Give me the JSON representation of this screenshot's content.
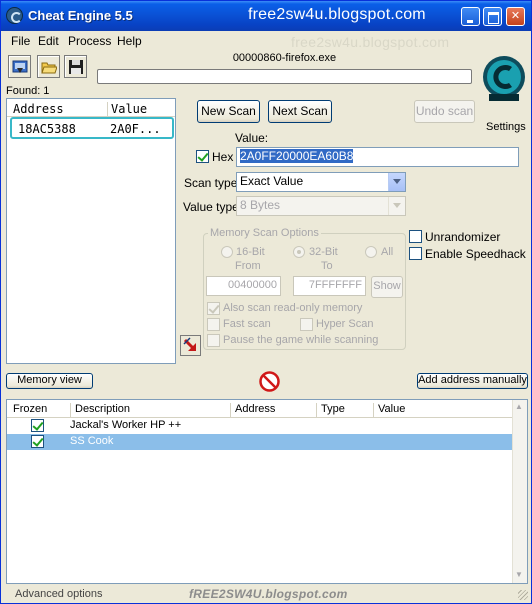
{
  "window": {
    "title": "Cheat Engine 5.5",
    "watermark_title": "free2sw4u.blogspot.com",
    "watermark_ghost": "free2sw4u.blogspot.com"
  },
  "menu": [
    {
      "label": "File",
      "accel": "F"
    },
    {
      "label": "Edit",
      "accel": "E"
    },
    {
      "label": "Process",
      "accel": "P"
    },
    {
      "label": "Help",
      "accel": "H"
    }
  ],
  "toolbar": {
    "icons": [
      "open-process-icon",
      "open-folder-icon",
      "save-icon"
    ]
  },
  "process": {
    "name": "00000860-firefox.exe"
  },
  "found": {
    "label": "Found: 1"
  },
  "settings_label": "Settings",
  "results": {
    "headers": {
      "address": "Address",
      "value": "Value"
    },
    "rows": [
      {
        "address": "18AC5388",
        "value": "2A0F..."
      }
    ]
  },
  "scan": {
    "new_scan": "New Scan",
    "next_scan": "Next Scan",
    "undo_scan": "Undo scan",
    "value_label": "Value:",
    "hex_label": "Hex",
    "hex_checked": true,
    "value": "2A0FF20000EA60B8",
    "scan_type_label": "Scan type",
    "scan_type": "Exact Value",
    "value_type_label": "Value type",
    "value_type": "8 Bytes"
  },
  "memory_options": {
    "title": "Memory Scan Options",
    "bits": [
      {
        "label": "16-Bit",
        "checked": false
      },
      {
        "label": "32-Bit",
        "checked": true
      },
      {
        "label": "All",
        "checked": false
      }
    ],
    "from_label": "From",
    "to_label": "To",
    "from_value": "00400000",
    "to_value": "7FFFFFFF",
    "show_label": "Show",
    "readonly_label": "Also scan read-only memory",
    "readonly_checked": true,
    "fastscan_label": "Fast scan",
    "hyperscan_label": "Hyper Scan",
    "pause_label": "Pause the game while scanning"
  },
  "extra_options": {
    "unrandomizer": "Unrandomizer",
    "speedhack": "Enable Speedhack"
  },
  "memory_view": "Memory view",
  "add_address": "Add address manually",
  "address_list": {
    "headers": [
      "Frozen",
      "Description",
      "Address",
      "Type",
      "Value"
    ],
    "rows": [
      {
        "frozen": true,
        "description": "Jackal's Worker HP ++",
        "address": "",
        "type": "",
        "value": ""
      },
      {
        "frozen": true,
        "description": "SS Cook",
        "address": "",
        "type": "",
        "value": "",
        "selected": true
      }
    ]
  },
  "advanced_options": "Advanced options",
  "footer_watermark": "fREE2SW4U.blogspot.com",
  "colors": {
    "titlebar": "#0a52d6",
    "selected_row": "#8bbee9",
    "result_highlight": "#38b8c8",
    "hex_selection": "#316ac5"
  }
}
